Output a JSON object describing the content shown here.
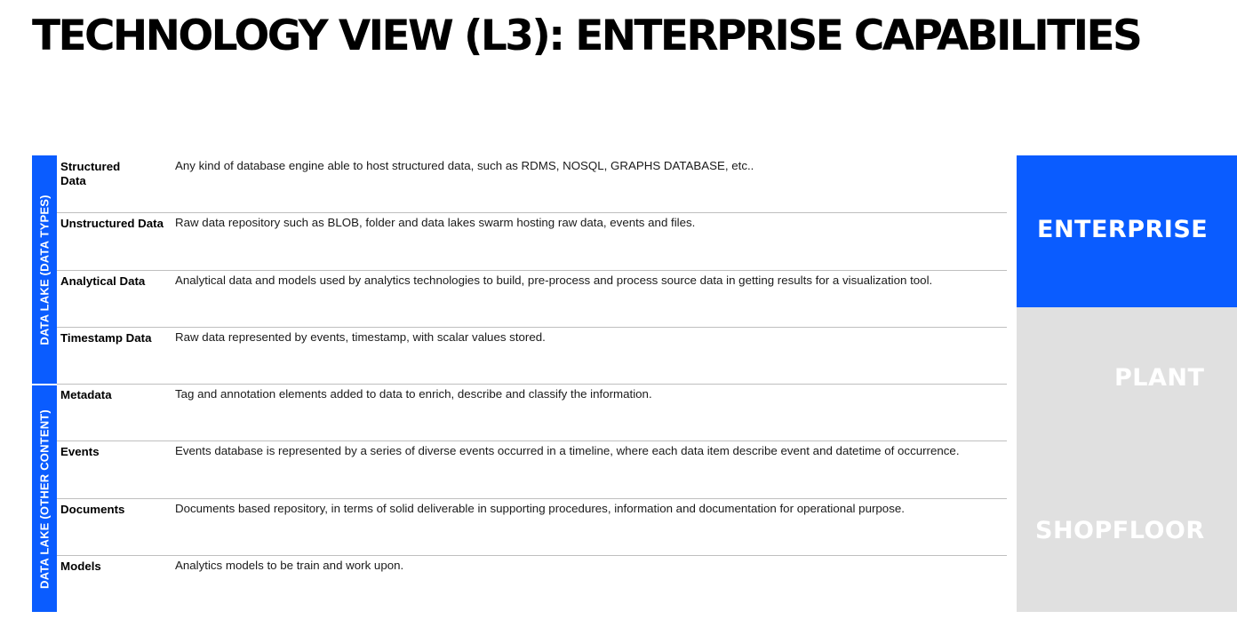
{
  "title": "TECHNOLOGY VIEW (L3): ENTERPRISE CAPABILITIES",
  "colors": {
    "accent": "#0a5cff",
    "grey_panel": "#e0e0e0",
    "divider": "#bfbfbf"
  },
  "groups": [
    {
      "label": "DATA LAKE (DATA TYPES)"
    },
    {
      "label": "DATA LAKE (OTHER CONTENT)"
    }
  ],
  "rows": [
    {
      "name": "Structured Data",
      "desc": "Any kind of database engine able to host structured data, such as RDMS, NOSQL, GRAPHS DATABASE, etc.."
    },
    {
      "name": "Unstructured Data",
      "desc": "Raw data repository such as BLOB, folder and data lakes swarm hosting raw data, events and files."
    },
    {
      "name": "Analytical Data",
      "desc": "Analytical data and models used by analytics technologies to build, pre-process and process source data in getting results for a visualization tool."
    },
    {
      "name": "Timestamp Data",
      "desc": "Raw data represented by events, timestamp, with scalar values stored."
    },
    {
      "name": "Metadata",
      "desc": "Tag and annotation elements added to data to enrich, describe and classify the information."
    },
    {
      "name": "Events",
      "desc": "Events database is represented by a series of diverse events occurred in a timeline, where each data item describe event and datetime of occurrence."
    },
    {
      "name": "Documents",
      "desc": "Documents based repository, in terms of solid deliverable in supporting procedures, information and documentation for operational purpose."
    },
    {
      "name": "Models",
      "desc": "Analytics models to be train and work upon."
    }
  ],
  "side": {
    "enterprise": "ENTERPRISE",
    "plant": "PLANT",
    "shopfloor": "SHOPFLOOR"
  }
}
